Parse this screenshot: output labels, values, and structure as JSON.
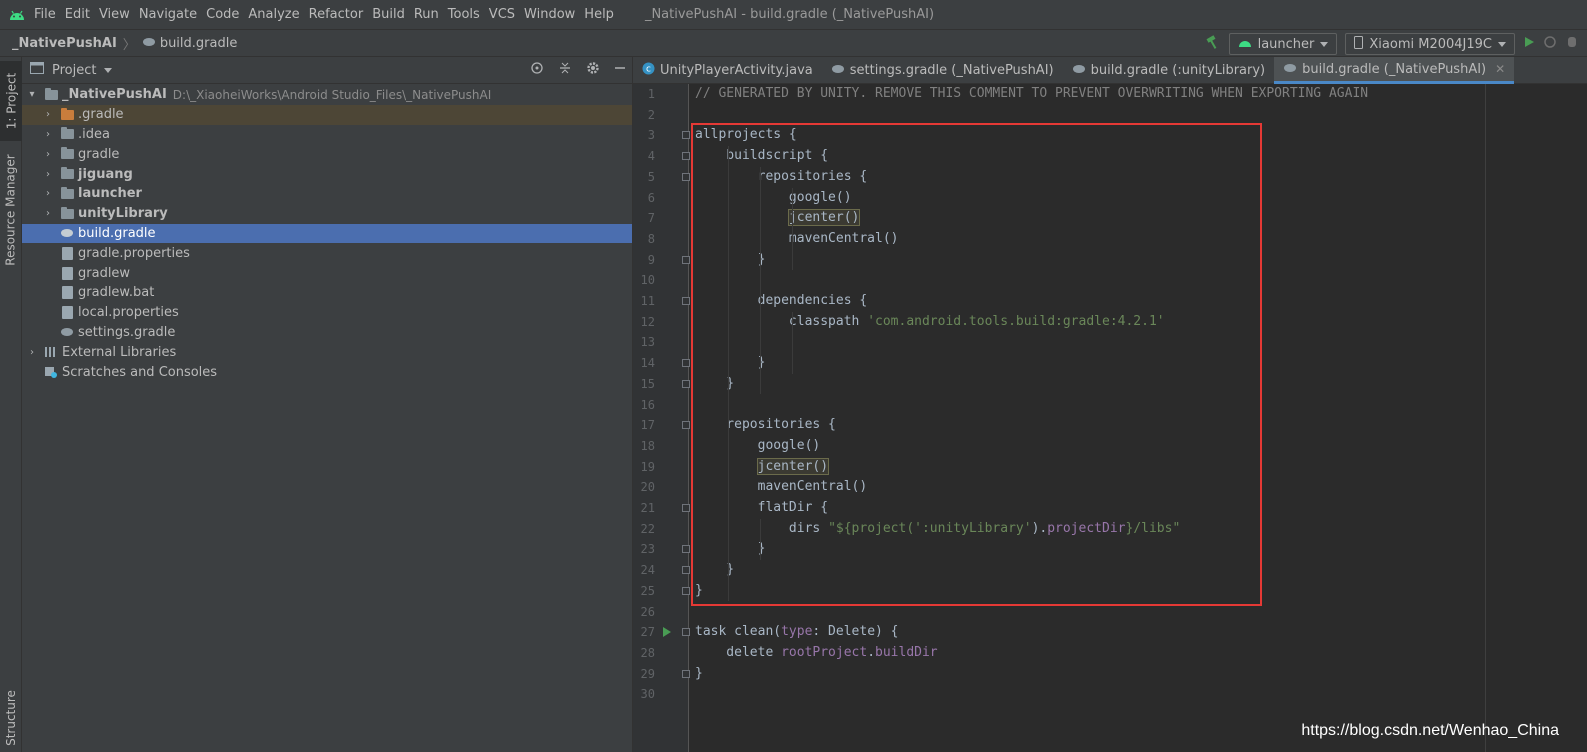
{
  "menubar": {
    "items": [
      "File",
      "Edit",
      "View",
      "Navigate",
      "Code",
      "Analyze",
      "Refactor",
      "Build",
      "Run",
      "Tools",
      "VCS",
      "Window",
      "Help"
    ],
    "window_title": "_NativePushAI - build.gradle (_NativePushAI)"
  },
  "navbar": {
    "project": "_NativePushAI",
    "file": "build.gradle",
    "run_config": "launcher",
    "device": "Xiaomi M2004J19C"
  },
  "left_stripe": {
    "project_tab": "1: Project",
    "resource_tab": "Resource Manager",
    "structure_tab": "Structure"
  },
  "project_panel": {
    "title": "Project",
    "root": {
      "name": "_NativePushAI",
      "path": "D:\\_XiaoheiWorks\\Android Studio_Files\\_NativePushAI"
    },
    "items": [
      {
        "label": ".gradle",
        "bold": false
      },
      {
        "label": ".idea",
        "bold": false
      },
      {
        "label": "gradle",
        "bold": false
      },
      {
        "label": "jiguang",
        "bold": true
      },
      {
        "label": "launcher",
        "bold": true
      },
      {
        "label": "unityLibrary",
        "bold": true
      },
      {
        "label": "build.gradle",
        "bold": false
      },
      {
        "label": "gradle.properties",
        "bold": false
      },
      {
        "label": "gradlew",
        "bold": false
      },
      {
        "label": "gradlew.bat",
        "bold": false
      },
      {
        "label": "local.properties",
        "bold": false
      },
      {
        "label": "settings.gradle",
        "bold": false
      },
      {
        "label": "External Libraries",
        "bold": false
      },
      {
        "label": "Scratches and Consoles",
        "bold": false
      }
    ]
  },
  "tabs": [
    {
      "label": "UnityPlayerActivity.java"
    },
    {
      "label": "settings.gradle (_NativePushAI)"
    },
    {
      "label": "build.gradle (:unityLibrary)"
    },
    {
      "label": "build.gradle (_NativePushAI)"
    }
  ],
  "code": {
    "line_numbers": [
      "1",
      "2",
      "3",
      "4",
      "5",
      "6",
      "7",
      "8",
      "9",
      "10",
      "11",
      "12",
      "13",
      "14",
      "15",
      "16",
      "17",
      "18",
      "19",
      "20",
      "21",
      "22",
      "23",
      "24",
      "25",
      "26",
      "27",
      "28",
      "29",
      "30"
    ],
    "l1": "// GENERATED BY UNITY. REMOVE THIS COMMENT TO PREVENT OVERWRITING WHEN EXPORTING AGAIN",
    "l3": "allprojects {",
    "l4": "    buildscript {",
    "l5": "        repositories {",
    "l6": "            google()",
    "l7": "jcenter()",
    "l8": "            mavenCentral()",
    "l9": "        }",
    "l11": "        dependencies {",
    "l12a": "            classpath ",
    "l12b": "'com.android.tools.build:gradle:4.2.1'",
    "l14": "        }",
    "l15": "    }",
    "l17": "    repositories {",
    "l18": "        google()",
    "l19": "jcenter()",
    "l20": "        mavenCentral()",
    "l21": "        flatDir {",
    "l22a": "            dirs ",
    "l22b": "\"${project(",
    "l22c": "':unityLibrary'",
    "l22d": ").",
    "l22e": "projectDir",
    "l22f": "}/libs\"",
    "l23": "        }",
    "l24": "    }",
    "l25": "}",
    "l27a": "task clean(",
    "l27b": "type",
    "l27c": ": Delete) {",
    "l28a": "    delete ",
    "l28b": "rootProject",
    "l28c": ".",
    "l28d": "buildDir",
    "l29": "}"
  },
  "watermark": "https://blog.csdn.net/Wenhao_China",
  "colors": {
    "selection": "#4b6eaf",
    "annotation_box": "#e53935",
    "string": "#6a8759",
    "property": "#9876aa"
  }
}
